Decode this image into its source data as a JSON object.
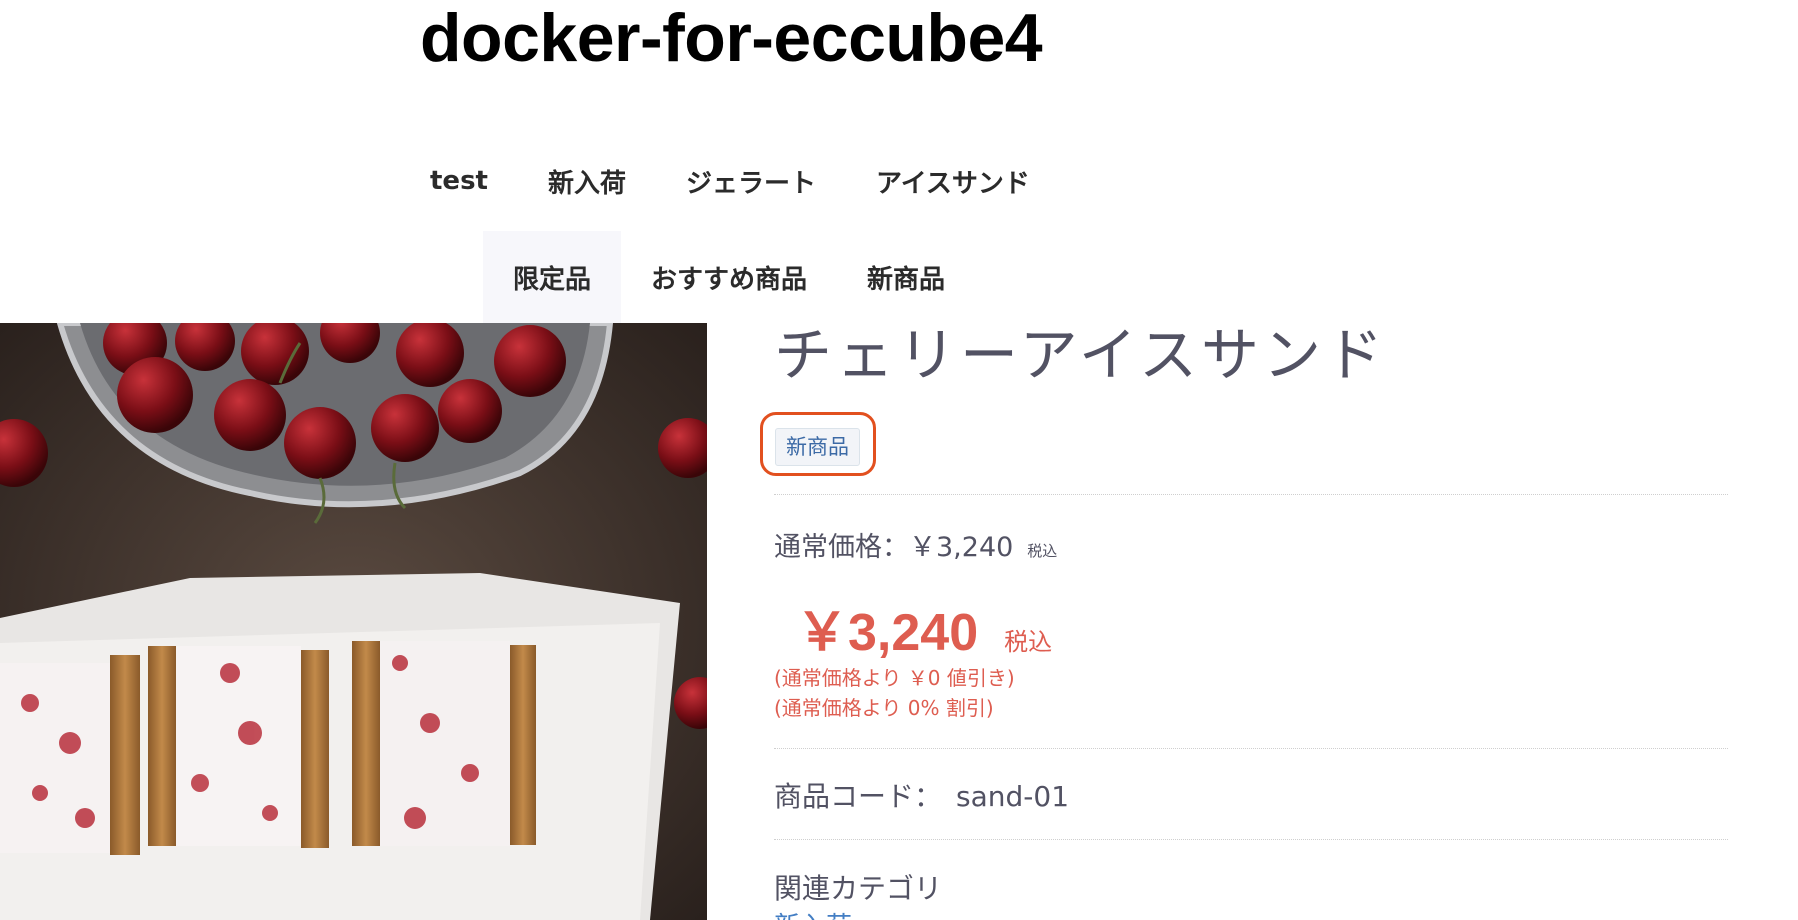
{
  "site": {
    "title": "docker-for-eccube4"
  },
  "nav": {
    "row1": [
      "test",
      "新入荷",
      "ジェラート",
      "アイスサンド"
    ],
    "row2": [
      "限定品",
      "おすすめ商品",
      "新商品"
    ],
    "active": "限定品"
  },
  "product": {
    "name": "チェリーアイスサンド",
    "tag": "新商品",
    "normal_price_label": "通常価格：￥3,240",
    "normal_price_tax": "税込",
    "sale_price": "￥3,240",
    "sale_price_tax": "税込",
    "discount_amount": "(通常価格より ￥0 値引き)",
    "discount_rate": "(通常価格より 0% 割引)",
    "code_label": "商品コード：",
    "code_value": "sand-01",
    "related_category_label": "関連カテゴリ",
    "related_category_link": "新入荷"
  },
  "image": {
    "alt_subject": "cherry ice sandwich"
  },
  "colors": {
    "accent_red": "#de5d50",
    "highlight_border": "#e2501f",
    "link_blue": "#437ec4",
    "tag_text": "#3c6aa6"
  }
}
